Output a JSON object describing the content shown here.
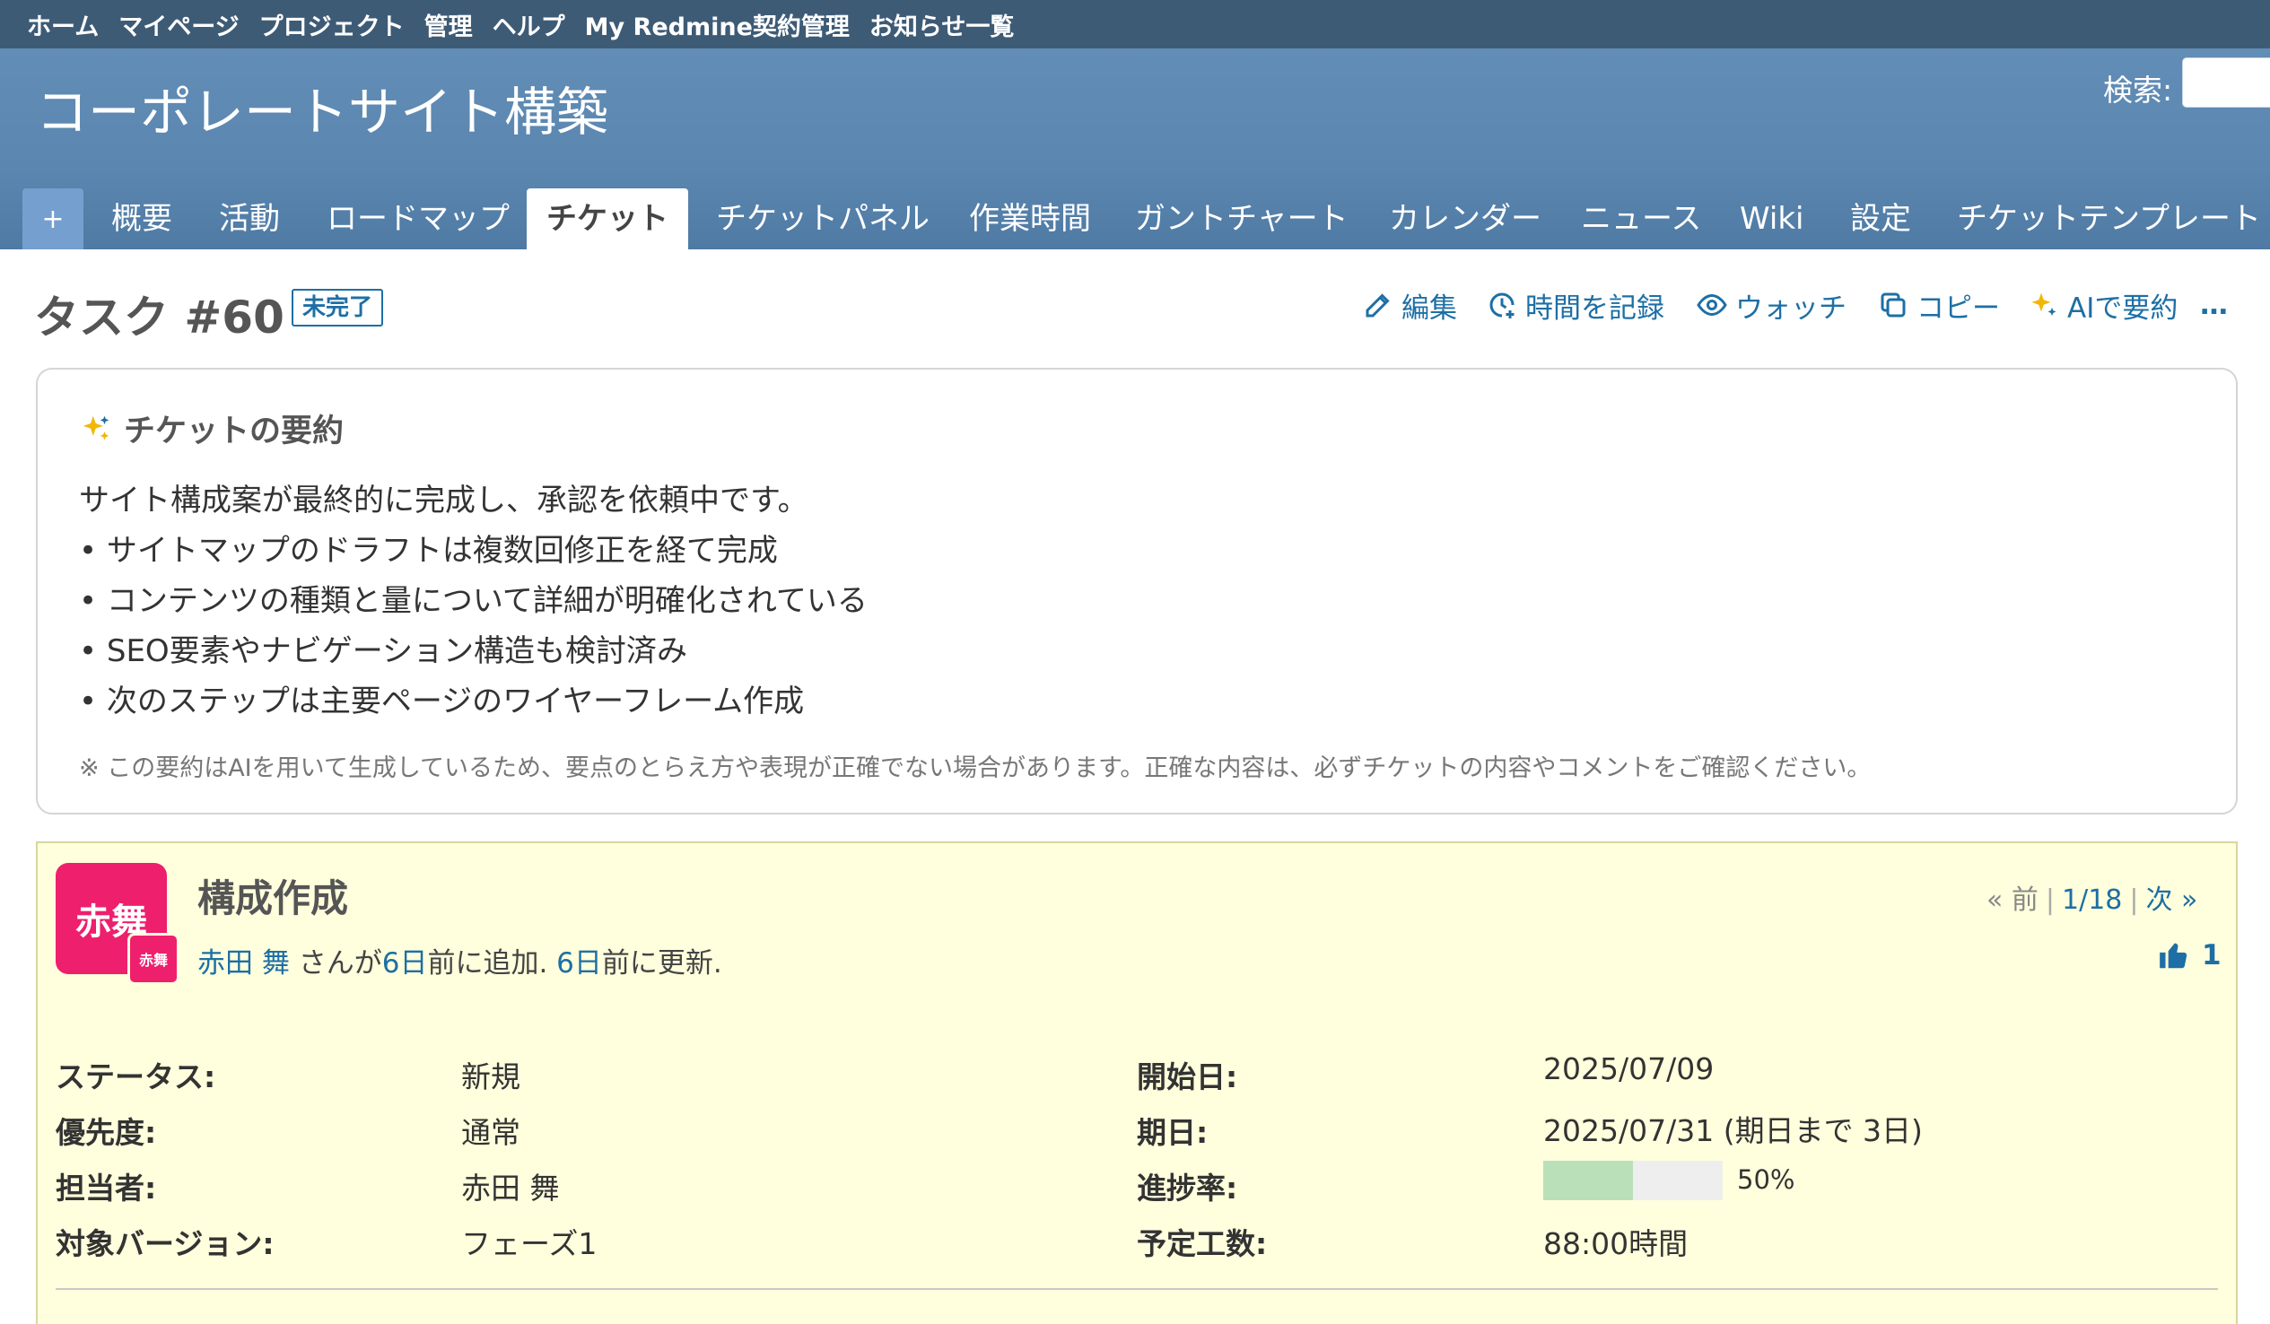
{
  "top_menu": [
    "ホーム",
    "マイページ",
    "プロジェクト",
    "管理",
    "ヘルプ",
    "My Redmine契約管理",
    "お知らせ一覧"
  ],
  "header": {
    "title": "コーポレートサイト構築",
    "search_label": "検索:",
    "search_value": ""
  },
  "tabs": {
    "plus": "+",
    "items": [
      "概要",
      "活動",
      "ロードマップ",
      "チケット",
      "チケットパネル",
      "作業時間",
      "ガントチャート",
      "カレンダー",
      "ニュース",
      "Wiki",
      "設定",
      "チケットテンプレート"
    ],
    "selected": "チケット"
  },
  "issue": {
    "title": "タスク #60",
    "status_badge": "未完了",
    "actions": [
      "編集",
      "時間を記録",
      "ウォッチ",
      "コピー",
      "AIで要約"
    ],
    "more": "…",
    "subject": "構成作成",
    "avatar_text": "赤舞",
    "author": "赤田 舞",
    "author_suffix": " さんが",
    "added_ago": "6日",
    "added_text": "前に追加. ",
    "updated_ago": "6日",
    "updated_text": "前に更新.",
    "pager": {
      "prev": "« 前",
      "position": "1/18",
      "next": "次 »"
    },
    "reaction_count": "1",
    "attributes": {
      "status": {
        "label": "ステータス:",
        "value": "新規"
      },
      "priority": {
        "label": "優先度:",
        "value": "通常"
      },
      "assignee": {
        "label": "担当者:",
        "value": "赤田 舞"
      },
      "version": {
        "label": "対象バージョン:",
        "value": "フェーズ1"
      },
      "start_date": {
        "label": "開始日:",
        "value": "2025/07/09"
      },
      "due_date": {
        "label": "期日:",
        "value": "2025/07/31 (期日まで 3日)"
      },
      "done_ratio": {
        "label": "進捗率:",
        "value": "50%",
        "fraction": 0.5
      },
      "estimated": {
        "label": "予定工数:",
        "value": "88:00時間"
      }
    }
  },
  "summary": {
    "heading": "チケットの要約",
    "lines": [
      "サイト構成案が最終的に完成し、承認を依頼中です。",
      "• サイトマップのドラフトは複数回修正を経て完成",
      "• コンテンツの種類と量について詳細が明確化されている",
      "• SEO要素やナビゲーション構造も検討済み",
      "• 次のステップは主要ページのワイヤーフレーム作成"
    ],
    "note": "※ この要約はAIを用いて生成しているため、要点のとらえ方や表現が正確でない場合があります。正確な内容は、必ずチケットの内容やコメントをご確認ください。"
  },
  "colors": {
    "link": "#1d6fa5",
    "header": "#628db6",
    "top_menu": "#3e5b76",
    "issue_bg": "#ffffdd",
    "avatar": "#ee1f6d",
    "progress": "#bae0ba"
  }
}
